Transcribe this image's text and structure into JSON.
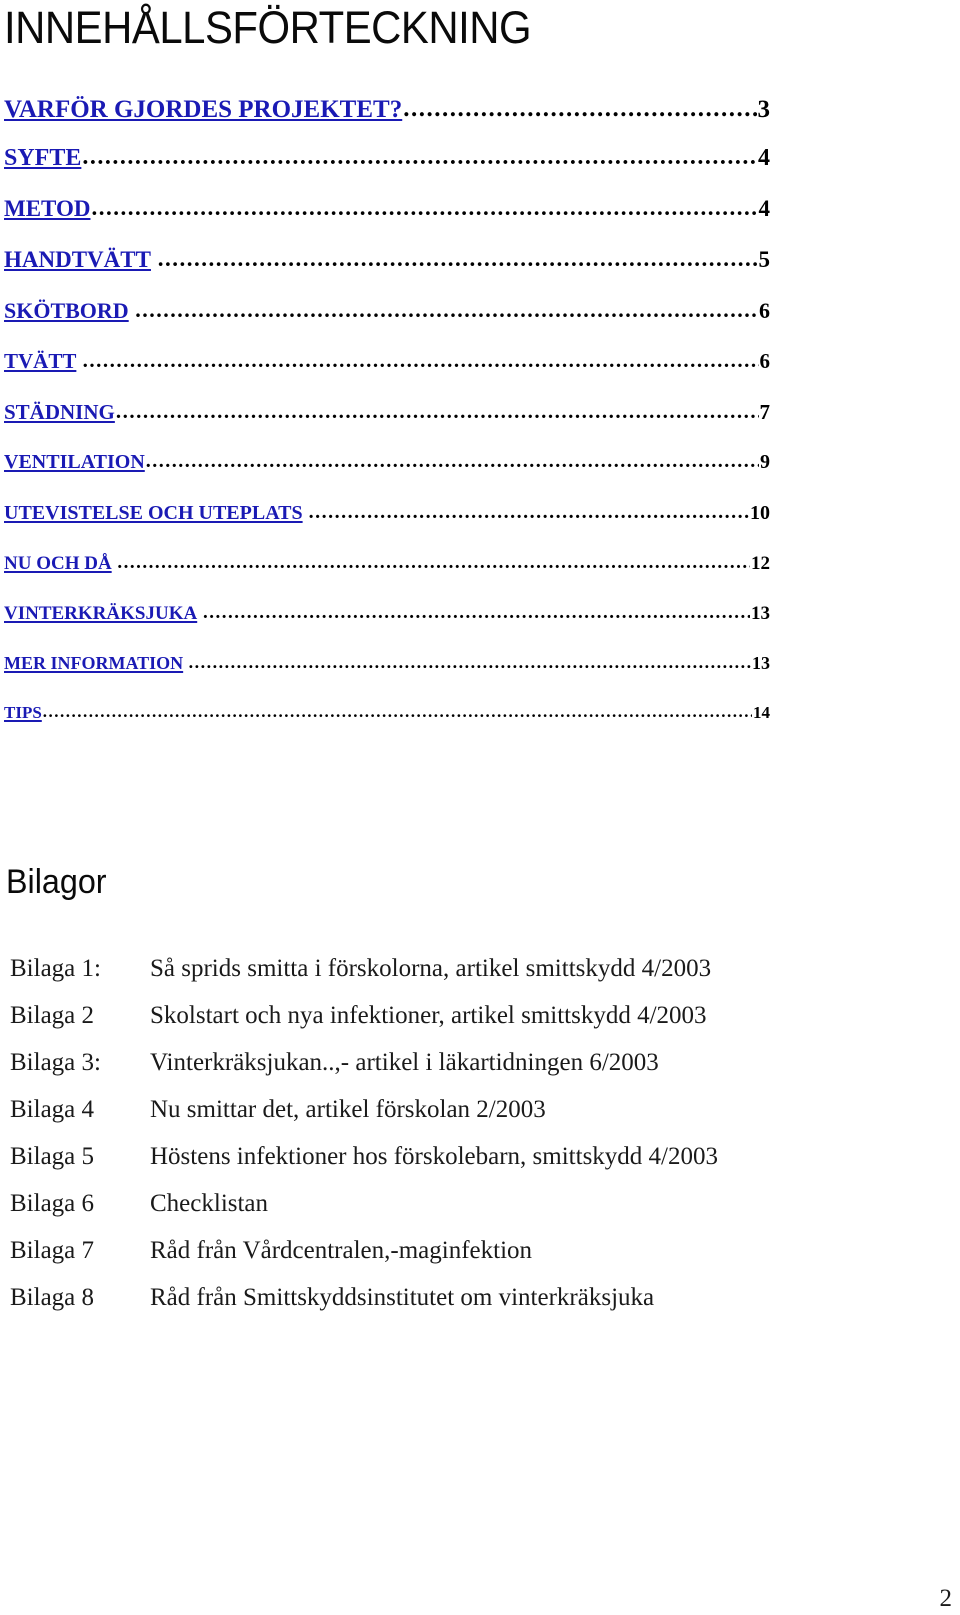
{
  "document": {
    "title": "INNEHÅLLSFÖRTECKNING",
    "page_number": "2",
    "link_color": "#1a1ab4",
    "text_color": "#000000",
    "background_color": "#ffffff"
  },
  "toc": {
    "entries": [
      {
        "label": "VARFÖR GJORDES PROJEKTET?",
        "page": "3"
      },
      {
        "label": "SYFTE",
        "page": "4"
      },
      {
        "label": "METOD",
        "page": "4"
      },
      {
        "label": "HANDTVÄTT",
        "page": "5"
      },
      {
        "label": "SKÖTBORD",
        "page": "6"
      },
      {
        "label": "TVÄTT",
        "page": "6"
      },
      {
        "label": "STÄDNING",
        "page": "7"
      },
      {
        "label": "VENTILATION",
        "page": "9"
      },
      {
        "label": "UTEVISTELSE OCH UTEPLATS",
        "page": "10"
      },
      {
        "label": "NU OCH DÅ",
        "page": "12"
      },
      {
        "label": "VINTERKRÄKSJUKA",
        "page": "13"
      },
      {
        "label": "MER INFORMATION",
        "page": "13"
      },
      {
        "label": "TIPS",
        "page": "14"
      }
    ]
  },
  "appendix": {
    "heading": "Bilagor",
    "items": [
      {
        "label": "Bilaga 1:",
        "description": "Så sprids smitta i förskolorna, artikel smittskydd 4/2003"
      },
      {
        "label": "Bilaga 2",
        "description": "Skolstart och nya infektioner, artikel smittskydd 4/2003"
      },
      {
        "label": "Bilaga 3:",
        "description": "Vinterkräksjukan..,- artikel i läkartidningen 6/2003"
      },
      {
        "label": "Bilaga 4",
        "description": "Nu smittar det, artikel förskolan 2/2003"
      },
      {
        "label": "Bilaga 5",
        "description": "Höstens infektioner hos förskolebarn, smittskydd 4/2003"
      },
      {
        "label": "Bilaga 6",
        "description": "Checklistan"
      },
      {
        "label": "Bilaga 7",
        "description": "Råd från Vårdcentralen,-maginfektion"
      },
      {
        "label": "Bilaga 8",
        "description": "Råd från Smittskyddsinstitutet om vinterkräksjuka"
      }
    ]
  }
}
